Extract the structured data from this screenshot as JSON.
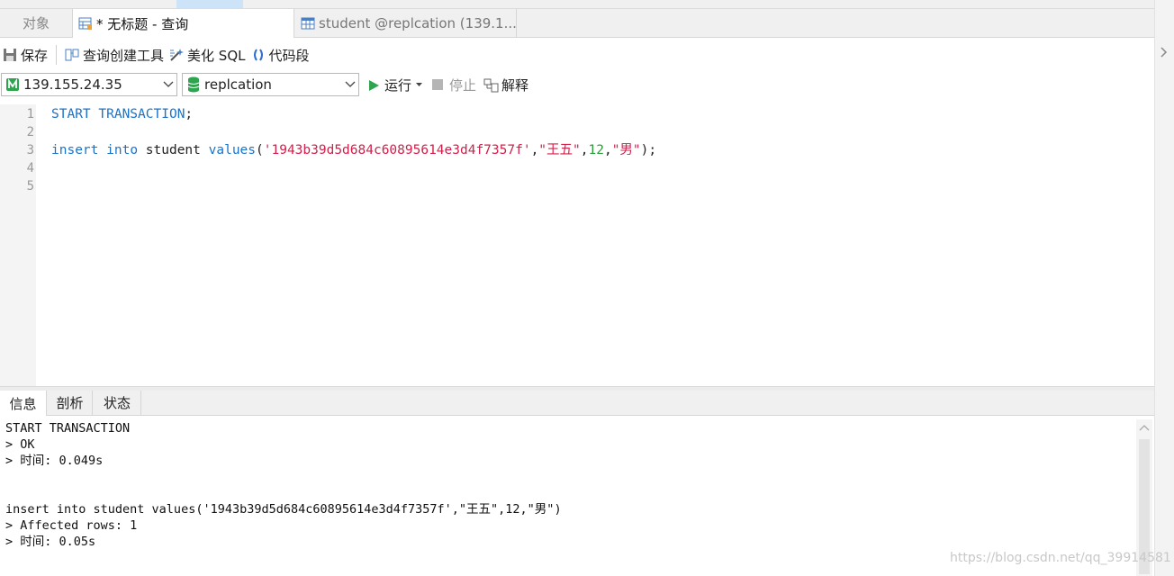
{
  "tabs": {
    "objects": "对象",
    "query": "* 无标题 - 查询",
    "student": "student @replcation (139.1..."
  },
  "toolbar": {
    "save": "保存",
    "query_builder": "查询创建工具",
    "beautify": "美化 SQL",
    "snippet": "代码段"
  },
  "connection": {
    "host": "139.155.24.35",
    "database": "replcation"
  },
  "run_bar": {
    "run": "运行",
    "stop": "停止",
    "explain": "解释"
  },
  "editor": {
    "line_numbers": [
      "1",
      "2",
      "3",
      "4",
      "5"
    ],
    "line1": {
      "kw1": "START",
      "kw2": "TRANSACTION",
      "end": ";"
    },
    "line3": {
      "kw_insert": "insert",
      "kw_into": "into",
      "table": "student",
      "kw_values": "values",
      "open": "(",
      "s1": "'1943b39d5d684c60895614e3d4f7357f'",
      "c1": ",",
      "s2": "\"王五\"",
      "c2": ",",
      "n1": "12",
      "c3": ",",
      "s3": "\"男\"",
      "close": ");"
    }
  },
  "bottom_tabs": {
    "info": "信息",
    "profile": "剖析",
    "status": "状态"
  },
  "output": {
    "lines": [
      "START TRANSACTION",
      "> OK",
      "> 时间: 0.049s",
      "",
      "",
      "insert into student values('1943b39d5d684c60895614e3d4f7357f',\"王五\",12,\"男\")",
      "> Affected rows: 1",
      "> 时间: 0.05s"
    ]
  },
  "watermark": "https://blog.csdn.net/qq_39914581",
  "colors": {
    "keyword": "#1a73c9",
    "string": "#d21f4a",
    "number": "#2a9d3a",
    "run_green": "#2ea44f"
  }
}
